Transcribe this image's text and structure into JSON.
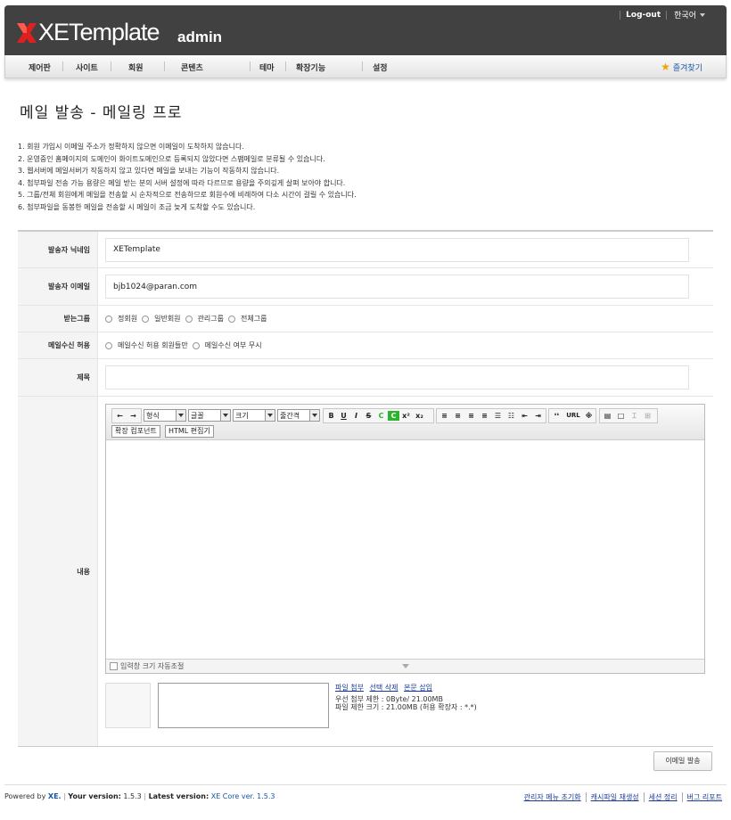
{
  "header": {
    "logo_text": "XETemplate",
    "logo_admin": "admin",
    "logout": "Log-out",
    "language": "한국어"
  },
  "nav": {
    "items": [
      "제어판",
      "사이트",
      "회원",
      "콘텐츠",
      "테마",
      "확장기능",
      "설정"
    ],
    "favorites": "즐겨찾기"
  },
  "page_title": "메일 발송 - 메일링 프로",
  "notes": [
    "1. 회원 가입시 이메일 주소가 정확하지 않으면 이메일이 도착하지 않습니다.",
    "2. 운영중인 홈페이지의 도메인이 화이트도메인으로 등록되지 않았다면 스팸메일로 분류될 수 있습니다.",
    "3. 웹서버에 메일서버가 작동하지 않고 있다면 메일을 보내는 기능이 작동하지 않습니다.",
    "4. 첨부파일 전송 가능 용량은 메일 받는 분의 서버 설정에 따라 다르므로 용량을 주의깊게 살펴 보아야 합니다.",
    "5. 그룹/전체 회원에게 메일을 전송할 시 순차적으로 전송하므로 회원수에 비례하여 다소 시간이 걸릴 수 있습니다.",
    "6. 첨부파일을 동봉한 메일을 전송할 시 메일이 조금 늦게 도착할 수도 있습니다."
  ],
  "form": {
    "sender_name_label": "발송자 닉네임",
    "sender_name_value": "XETemplate",
    "sender_email_label": "발송자 이메일",
    "sender_email_value": "bjb1024@paran.com",
    "group_label": "받는그룹",
    "groups": [
      "정회원",
      "일반회원",
      "관리그룹",
      "전체그룹"
    ],
    "receive_label": "메일수신 허용",
    "receive_options": [
      "메일수신 허용 회원들만",
      "메일수신 여부 무시"
    ],
    "subject_label": "제목",
    "subject_value": "",
    "content_label": "내용"
  },
  "editor": {
    "select_format": "형식",
    "select_font": "글꼴",
    "select_size": "크기",
    "select_lineheight": "줄간격",
    "btn_bold": "B",
    "btn_underline": "U",
    "btn_italic": "I",
    "btn_strike": "S",
    "btn_color": "C",
    "btn_bgcolor": "C",
    "btn_sup": "x²",
    "btn_sub": "x₂",
    "btn_quote": "❛❛",
    "btn_url": "URL",
    "btn_special": "※",
    "ext_component": "확장 컴포넌트",
    "html_editor": "HTML 편집기",
    "autoresize": "입력창 크기 자동조절"
  },
  "attach": {
    "file_attach": "파일 첨부",
    "delete_selected": "선택 삭제",
    "insert_body": "본문 삽입",
    "limit_line1": "우선 첨부 제한 : 0Byte/ 21.00MB",
    "limit_line2": "파일 제한 크기 : 21.00MB (허용 확장자 : *.*)"
  },
  "send_button": "이메일 발송",
  "footer": {
    "powered_by": "Powered by",
    "xe": "XE.",
    "your_version_label": "Your version:",
    "your_version": "1.5.3",
    "latest_label": "Latest version:",
    "latest_link": "XE Core ver. 1.5.3",
    "links": [
      "관리자 메뉴 초기화",
      "캐시파일 재생성",
      "세션 정리",
      "버그 리포트"
    ]
  },
  "colors": {
    "header_bg": "#414141",
    "logo_x": "#e0201f",
    "link": "#1a3a9a",
    "favorite_star": "#f0a30a",
    "color_btn": "#2db42d"
  }
}
